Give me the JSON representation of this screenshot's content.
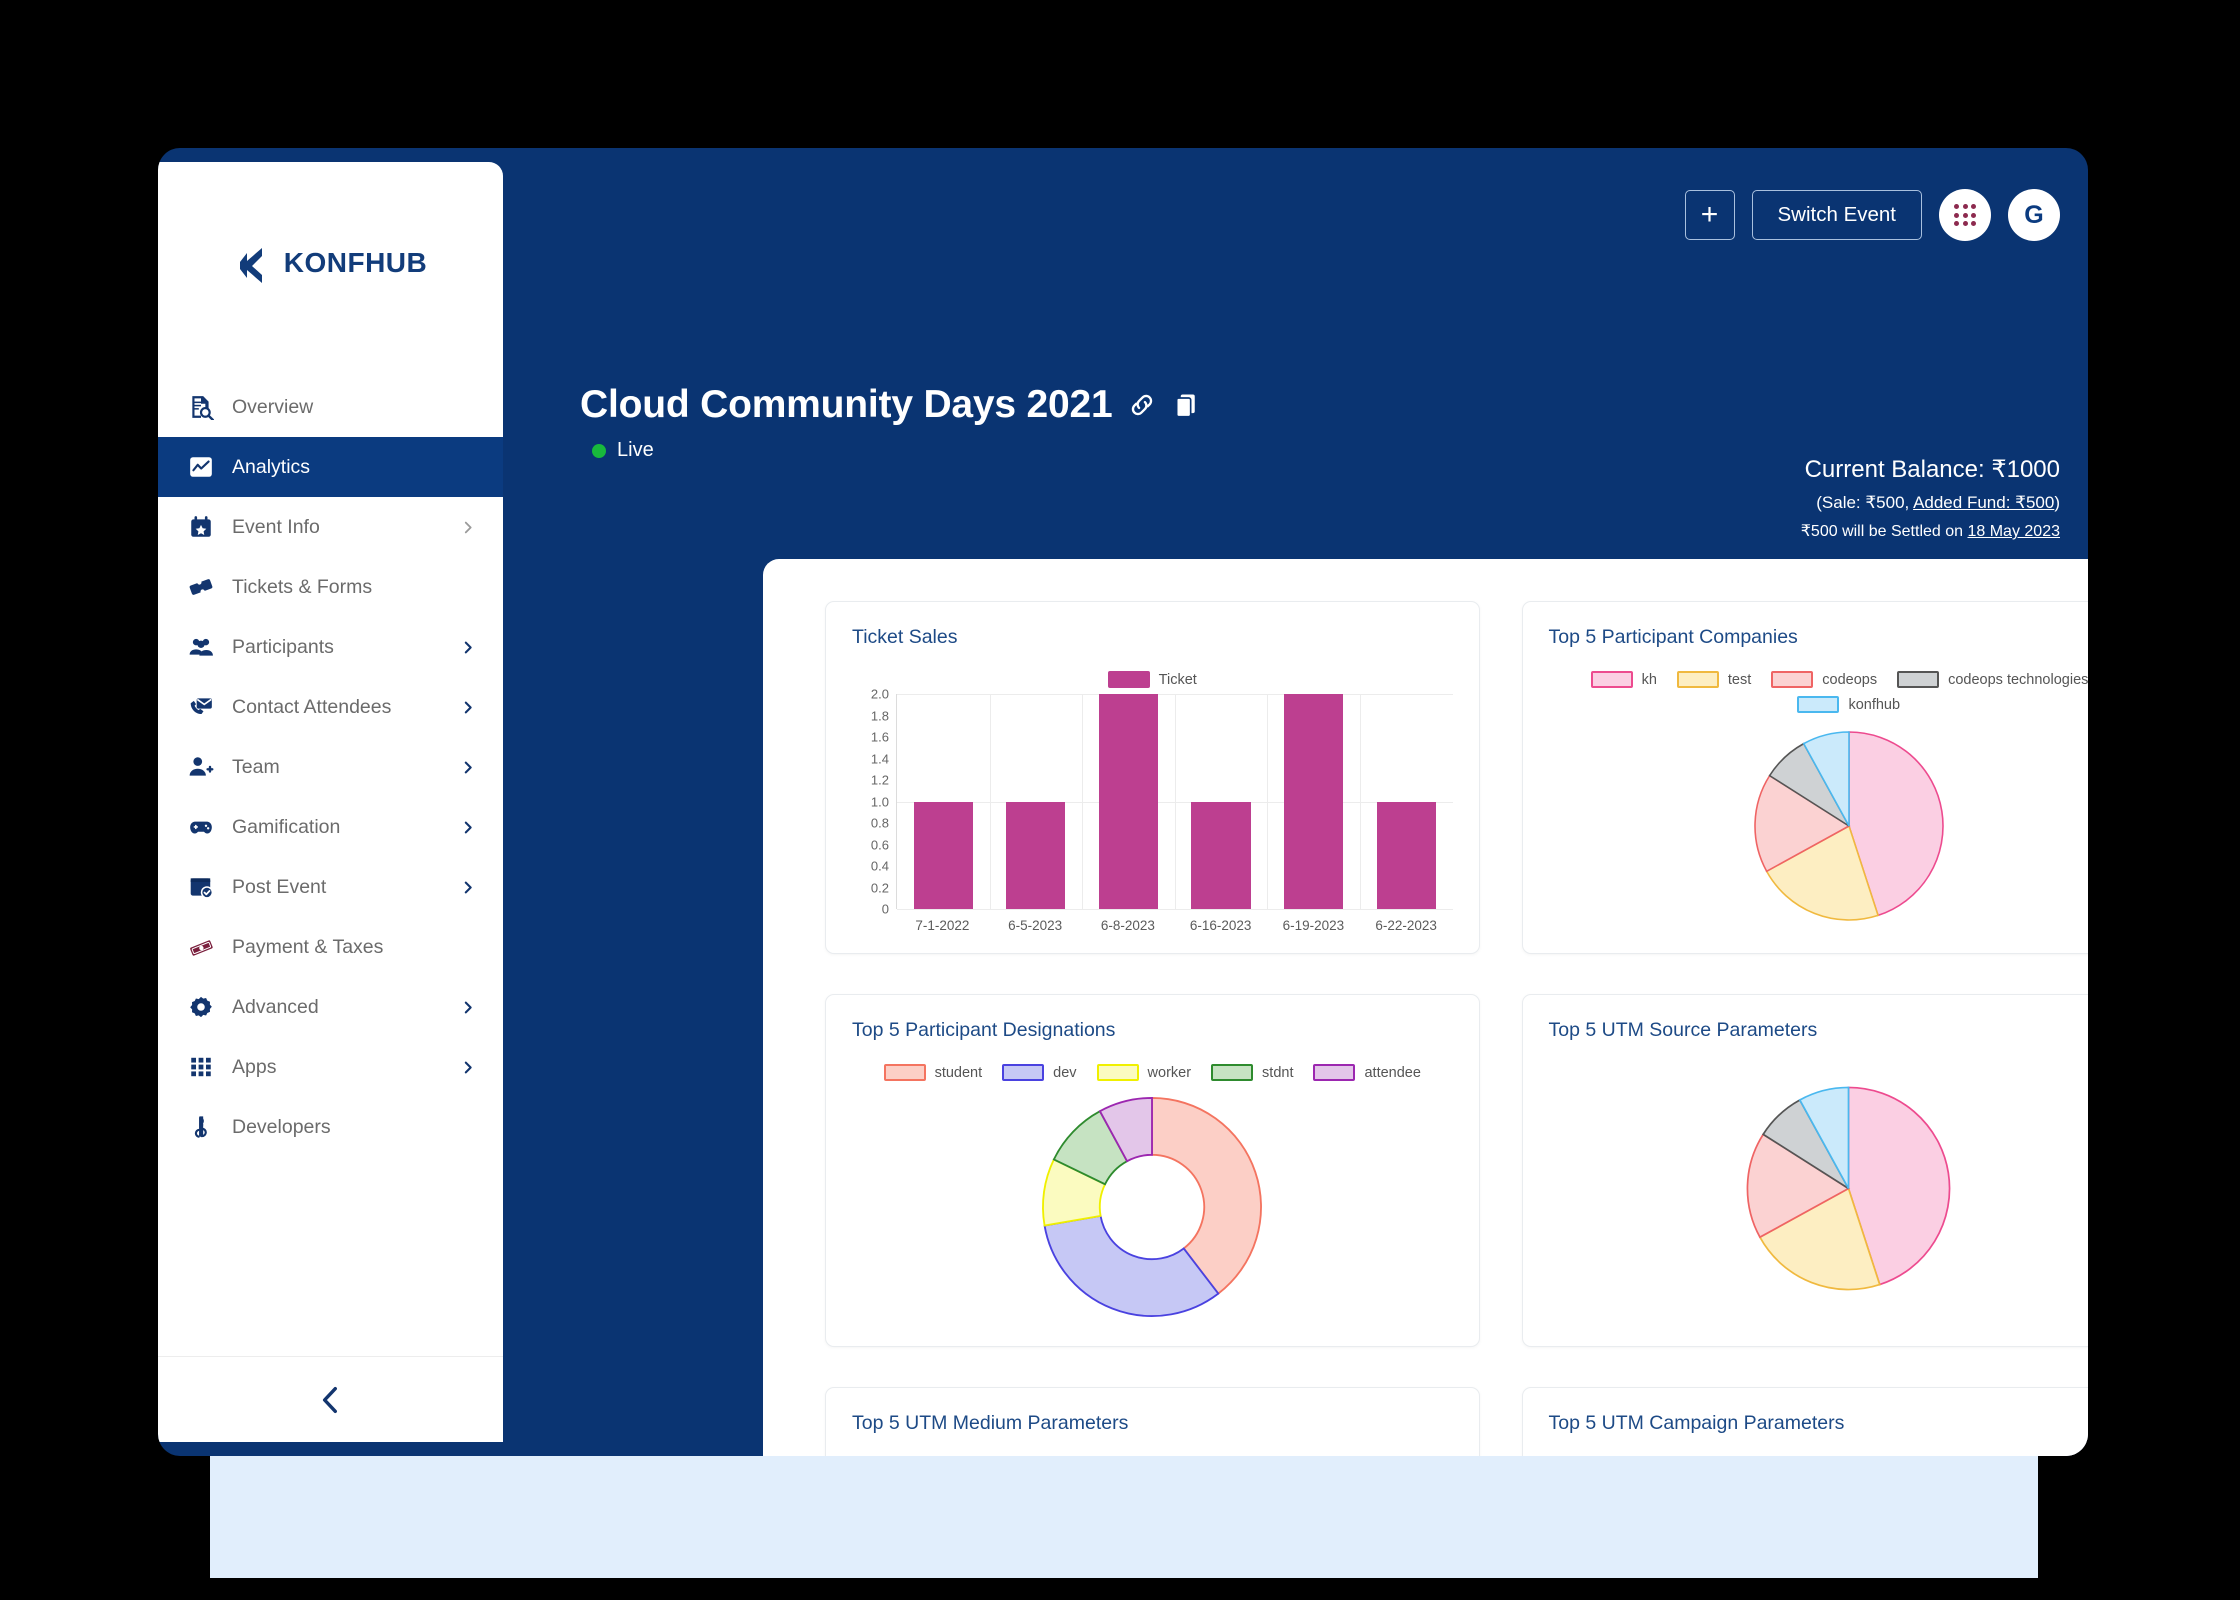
{
  "brand": {
    "name": "KONFHUB",
    "color": "#123c7a"
  },
  "sidebar": {
    "items": [
      {
        "label": "Overview",
        "icon": "document-search-icon",
        "chevron": false
      },
      {
        "label": "Analytics",
        "icon": "analytics-icon",
        "chevron": false,
        "active": true
      },
      {
        "label": "Event Info",
        "icon": "calendar-star-icon",
        "chevron": true,
        "chevron_color": "#9b9b9b"
      },
      {
        "label": "Tickets & Forms",
        "icon": "tickets-icon",
        "chevron": false
      },
      {
        "label": "Participants",
        "icon": "people-icon",
        "chevron": true,
        "chevron_color": "#13356e"
      },
      {
        "label": "Contact Attendees",
        "icon": "mail-phone-icon",
        "chevron": true,
        "chevron_color": "#13356e"
      },
      {
        "label": "Team",
        "icon": "person-add-icon",
        "chevron": true,
        "chevron_color": "#13356e"
      },
      {
        "label": "Gamification",
        "icon": "gamepad-icon",
        "chevron": true,
        "chevron_color": "#13356e"
      },
      {
        "label": "Post Event",
        "icon": "calendar-check-icon",
        "chevron": true,
        "chevron_color": "#13356e"
      },
      {
        "label": "Payment & Taxes",
        "icon": "money-icon",
        "chevron": false
      },
      {
        "label": "Advanced",
        "icon": "gear-icon",
        "chevron": true,
        "chevron_color": "#13356e"
      },
      {
        "label": "Apps",
        "icon": "grid-apps-icon",
        "chevron": true,
        "chevron_color": "#13356e"
      },
      {
        "label": "Developers",
        "icon": "developers-icon",
        "chevron": false
      }
    ],
    "collapse_icon": "chevron-left-icon"
  },
  "header": {
    "add_label": "+",
    "switch_event_label": "Switch Event",
    "apps_icon": "grid-dots-icon",
    "avatar_letter": "G",
    "event_title": "Cloud Community Days 2021",
    "link_icon": "link-icon",
    "copy_icon": "copy-icon",
    "status_label": "Live",
    "status_color": "#18b93c",
    "balance_main": "Current Balance: ₹1000",
    "balance_sub_prefix": "(Sale: ₹500, ",
    "balance_sub_link": "Added Fund: ₹500",
    "balance_sub_suffix": ")",
    "settle_prefix": "₹500 will be Settled on ",
    "settle_date": "18 May 2023"
  },
  "cards": {
    "ticket_sales": "Ticket Sales",
    "companies": "Top 5 Participant Companies",
    "designations": "Top 5 Participant Designations",
    "utm_source": "Top 5 UTM Source Parameters",
    "utm_medium": "Top 5 UTM Medium Parameters",
    "utm_campaign": "Top 5 UTM Campaign Parameters"
  },
  "chart_data": [
    {
      "type": "bar",
      "title": "Ticket Sales",
      "categories": [
        "7-1-2022",
        "6-5-2023",
        "6-8-2023",
        "6-16-2023",
        "6-19-2023",
        "6-22-2023"
      ],
      "series": [
        {
          "name": "Ticket",
          "values": [
            1,
            1,
            2,
            1,
            2,
            1
          ],
          "color": "#bd3f90"
        }
      ],
      "legend": [
        "Ticket"
      ],
      "legend_position": "top",
      "yticks": [
        "0",
        "0.2",
        "0.4",
        "0.6",
        "0.8",
        "1.0",
        "1.2",
        "1.4",
        "1.6",
        "1.8",
        "2.0"
      ],
      "ylim": [
        0,
        2.0
      ],
      "xlabel": "",
      "ylabel": "",
      "grid": true
    },
    {
      "type": "pie",
      "title": "Top 5 Participant Companies",
      "labels": [
        "kh",
        "test",
        "codeops",
        "codeops technologies llp",
        "konfhub"
      ],
      "values": [
        45,
        22,
        17,
        8,
        8
      ],
      "colors": [
        "#fbcfe3",
        "#fdeec2",
        "#fbd2d2",
        "#cfd2d4",
        "#cbeafb"
      ],
      "stroke_colors": [
        "#ed4b8f",
        "#f0b93f",
        "#ef6464",
        "#555555",
        "#4ab8ef"
      ],
      "legend_position": "top"
    },
    {
      "type": "pie",
      "title": "Top 5 Participant Designations",
      "donut": true,
      "labels": [
        "student",
        "dev",
        "worker",
        "stdnt",
        "attendee"
      ],
      "values": [
        40,
        33,
        10,
        10,
        8
      ],
      "colors": [
        "#fccfc6",
        "#c6c8f5",
        "#fbfbc0",
        "#c6e3c2",
        "#e3c6e9"
      ],
      "stroke_colors": [
        "#f47460",
        "#4a42e0",
        "#f0f000",
        "#2e8b2e",
        "#9c27b0"
      ],
      "legend_position": "top"
    },
    {
      "type": "pie",
      "title": "Top 5 UTM Source Parameters",
      "labels": [],
      "values": [
        45,
        22,
        17,
        8,
        8
      ],
      "colors": [
        "#fbcfe3",
        "#fdeec2",
        "#fbd2d2",
        "#cfd2d4",
        "#cbeafb"
      ],
      "stroke_colors": [
        "#ed4b8f",
        "#f0b93f",
        "#ef6464",
        "#555555",
        "#4ab8ef"
      ],
      "legend_position": "none"
    }
  ]
}
